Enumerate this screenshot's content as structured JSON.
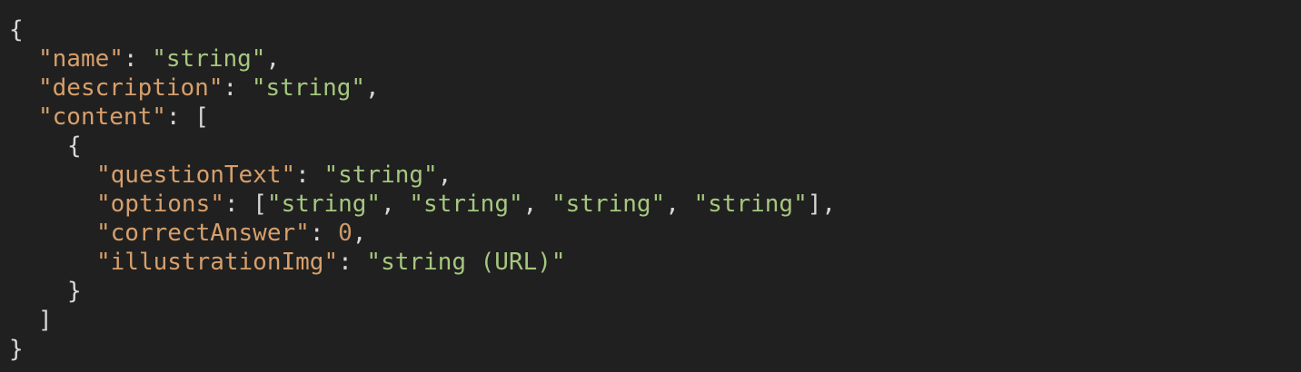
{
  "code": {
    "open_brace": "{",
    "close_brace": "}",
    "name_key": "\"name\"",
    "name_value": "\"string\"",
    "description_key": "\"description\"",
    "description_value": "\"string\"",
    "content_key": "\"content\"",
    "content_open": "[",
    "content_close": "]",
    "item_open": "{",
    "item_close": "}",
    "questionText_key": "\"questionText\"",
    "questionText_value": "\"string\"",
    "options_key": "\"options\"",
    "options_values": [
      "\"string\"",
      "\"string\"",
      "\"string\"",
      "\"string\""
    ],
    "correctAnswer_key": "\"correctAnswer\"",
    "correctAnswer_value": "0",
    "illustrationImg_key": "\"illustrationImg\"",
    "illustrationImg_value": "\"string (URL)\""
  },
  "colors": {
    "background": "#202020",
    "key": "#d79f6b",
    "string": "#a6c77f",
    "number": "#cc9a6a",
    "punctuation": "#d7d7d7"
  }
}
